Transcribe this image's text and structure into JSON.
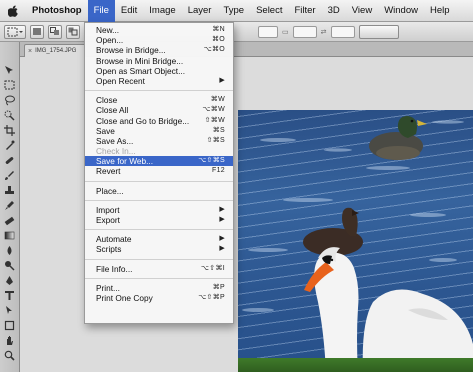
{
  "menubar": {
    "items": [
      {
        "label": "Photoshop"
      },
      {
        "label": "File"
      },
      {
        "label": "Edit"
      },
      {
        "label": "Image"
      },
      {
        "label": "Layer"
      },
      {
        "label": "Type"
      },
      {
        "label": "Select"
      },
      {
        "label": "Filter"
      },
      {
        "label": "3D"
      },
      {
        "label": "View"
      },
      {
        "label": "Window"
      },
      {
        "label": "Help"
      }
    ]
  },
  "document_tab": {
    "title": "IMG_1754.JPG",
    "close": "×"
  },
  "file_menu": {
    "items": [
      {
        "label": "New...",
        "shortcut": "⌘N"
      },
      {
        "label": "Open...",
        "shortcut": "⌘O"
      },
      {
        "label": "Browse in Bridge...",
        "shortcut": "⌥⌘O"
      },
      {
        "label": "Browse in Mini Bridge...",
        "shortcut": ""
      },
      {
        "label": "Open as Smart Object...",
        "shortcut": ""
      },
      {
        "label": "Open Recent",
        "shortcut": "▶"
      },
      {
        "label": "Close",
        "shortcut": "⌘W"
      },
      {
        "label": "Close All",
        "shortcut": "⌥⌘W"
      },
      {
        "label": "Close and Go to Bridge...",
        "shortcut": "⇧⌘W"
      },
      {
        "label": "Save",
        "shortcut": "⌘S"
      },
      {
        "label": "Save As...",
        "shortcut": "⇧⌘S"
      },
      {
        "label": "Check In...",
        "shortcut": ""
      },
      {
        "label": "Save for Web...",
        "shortcut": "⌥⇧⌘S"
      },
      {
        "label": "Revert",
        "shortcut": "F12"
      },
      {
        "label": "Place...",
        "shortcut": ""
      },
      {
        "label": "Import",
        "shortcut": "▶"
      },
      {
        "label": "Export",
        "shortcut": "▶"
      },
      {
        "label": "Automate",
        "shortcut": "▶"
      },
      {
        "label": "Scripts",
        "shortcut": "▶"
      },
      {
        "label": "File Info...",
        "shortcut": "⌥⇧⌘I"
      },
      {
        "label": "Print...",
        "shortcut": "⌘P"
      },
      {
        "label": "Print One Copy",
        "shortcut": "⌥⇧⌘P"
      }
    ]
  },
  "colors": {
    "highlight": "#3a66c8",
    "water": "#2c5690",
    "swan": "#f2f2f2",
    "beak": "#e8621c"
  },
  "icons": [
    "apple-icon",
    "move-tool-icon",
    "marquee-tool-icon",
    "lasso-tool-icon",
    "crop-tool-icon",
    "brush-tool-icon",
    "type-tool-icon",
    "hand-tool-icon",
    "zoom-tool-icon"
  ]
}
